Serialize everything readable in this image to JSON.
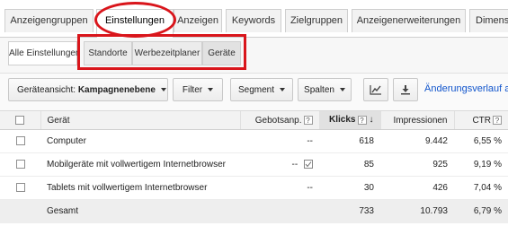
{
  "tabs": {
    "items": [
      {
        "label": "Anzeigengruppen"
      },
      {
        "label": "Einstellungen"
      },
      {
        "label": "Anzeigen"
      },
      {
        "label": "Keywords"
      },
      {
        "label": "Zielgruppen"
      },
      {
        "label": "Anzeigenerweiterungen"
      },
      {
        "label": "Dimensi"
      }
    ]
  },
  "subtabs": {
    "items": [
      {
        "label": "Alle Einstellungen"
      },
      {
        "label": "Standorte"
      },
      {
        "label": "Werbezeitplaner"
      },
      {
        "label": "Geräte"
      }
    ]
  },
  "toolbar": {
    "view_prefix": "Geräteansicht:",
    "view_value": "Kampagnenebene",
    "filter_label": "Filter",
    "segment_label": "Segment",
    "columns_label": "Spalten",
    "history_link": "Änderungsverlauf anz"
  },
  "table": {
    "headers": {
      "device": "Gerät",
      "bid": "Gebotsanp.",
      "clicks": "Klicks",
      "impressions": "Impressionen",
      "ctr": "CTR"
    },
    "help_glyph": "?",
    "sort_glyph": "↓",
    "rows": [
      {
        "device": "Computer",
        "bid": "--",
        "clicks": "618",
        "impressions": "9.442",
        "ctr": "6,55 %"
      },
      {
        "device": "Mobilgeräte mit vollwertigem Internetbrowser",
        "bid": "--",
        "clicks": "85",
        "impressions": "925",
        "ctr": "9,19 %"
      },
      {
        "device": "Tablets mit vollwertigem Internetbrowser",
        "bid": "--",
        "clicks": "30",
        "impressions": "426",
        "ctr": "7,04 %"
      }
    ],
    "total": {
      "label": "Gesamt",
      "clicks": "733",
      "impressions": "10.793",
      "ctr": "6,79 %"
    }
  },
  "colors": {
    "accent_red": "#d9151b",
    "link": "#1155cc"
  }
}
